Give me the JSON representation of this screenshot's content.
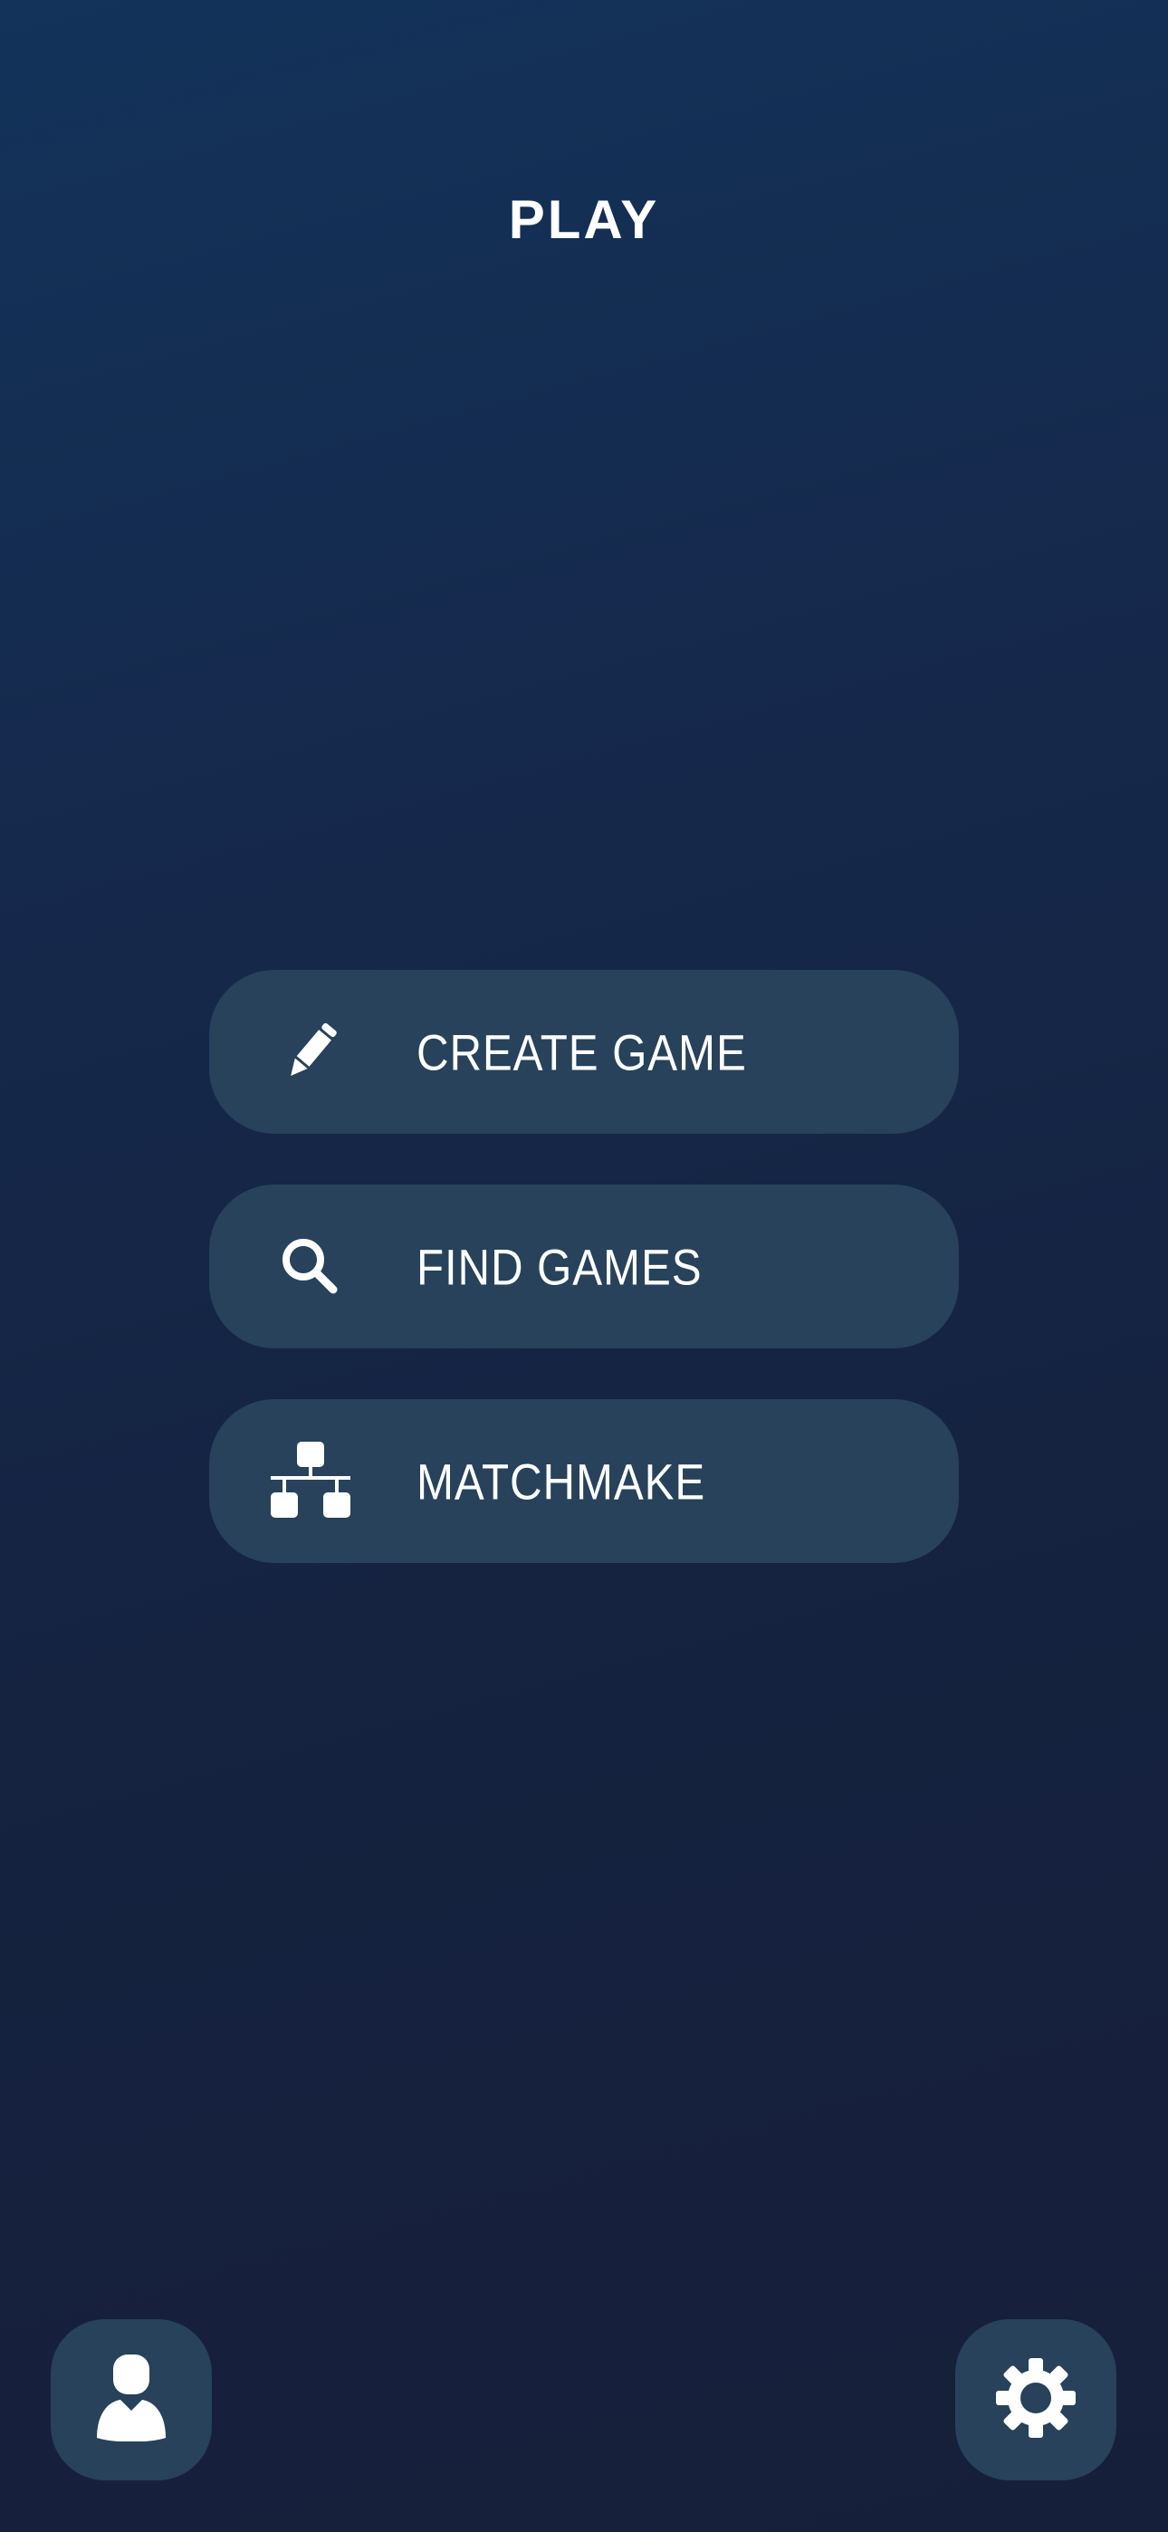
{
  "header": {
    "title": "PLAY"
  },
  "menu": {
    "items": [
      {
        "label": "CREATE GAME",
        "icon": "pencil-icon"
      },
      {
        "label": "FIND GAMES",
        "icon": "search-icon"
      },
      {
        "label": "MATCHMAKE",
        "icon": "network-icon"
      }
    ]
  },
  "footer": {
    "left_icon": "user-icon",
    "right_icon": "gear-icon"
  },
  "colors": {
    "background_top": "#13335a",
    "background_bottom": "#161f3a",
    "button": "#27425a",
    "text": "#ffffff"
  }
}
